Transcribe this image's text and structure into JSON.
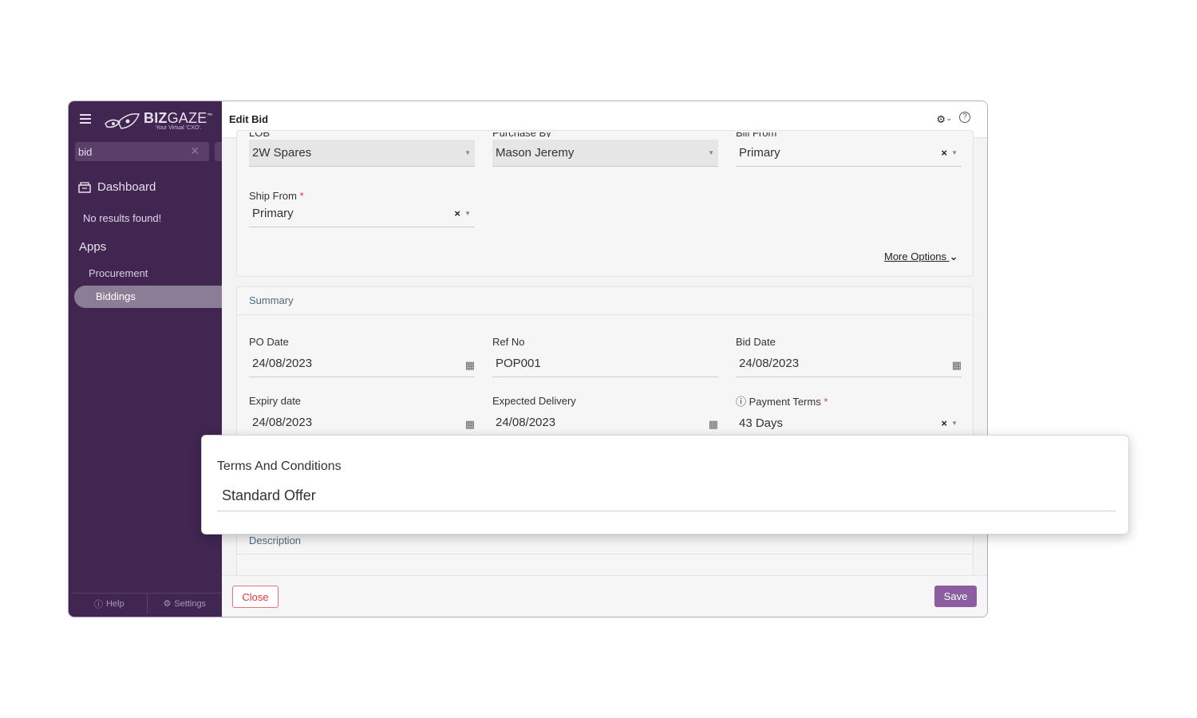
{
  "sidebar": {
    "logo_brand_bold": "BIZ",
    "logo_brand_thin": "GAZE",
    "logo_tm": "™",
    "logo_tagline": "Your Virtual 'CXO'.",
    "search_value": "bid",
    "dashboard_label": "Dashboard",
    "no_results": "No results found!",
    "apps_label": "Apps",
    "procurement_label": "Procurement",
    "biddings_label": "Biddings",
    "help_label": "Help",
    "settings_label": "Settings"
  },
  "header": {
    "title": "Edit Bid"
  },
  "form": {
    "row0": [
      {
        "label_cut": "LOB",
        "value": "2W Spares"
      },
      {
        "label_cut": "Purchase By",
        "value": "Mason Jeremy"
      },
      {
        "label_cut": "Bill From",
        "value": "Primary"
      }
    ],
    "ship_from_label": "Ship From",
    "ship_from_value": "Primary",
    "more_options": "More Options",
    "required_mark": "*"
  },
  "summary": {
    "title": "Summary",
    "po_date_label": "PO Date",
    "po_date_value": "24/08/2023",
    "ref_no_label": "Ref No",
    "ref_no_value": "POP001",
    "bid_date_label": "Bid Date",
    "bid_date_value": "24/08/2023",
    "expiry_label": "Expiry date",
    "expiry_value": "24/08/2023",
    "expected_label": "Expected Delivery",
    "expected_value": "24/08/2023",
    "payment_label": "Payment Terms",
    "payment_value": "43 Days",
    "description_label": "Description"
  },
  "popup": {
    "label": "Terms And Conditions",
    "value": "Standard Offer"
  },
  "footer": {
    "close_label": "Close",
    "save_label": "Save"
  },
  "colors": {
    "sidebar_bg": "#402651",
    "save_button": "#8b5f9f",
    "close_border": "#e57373",
    "required": "#e53935"
  }
}
